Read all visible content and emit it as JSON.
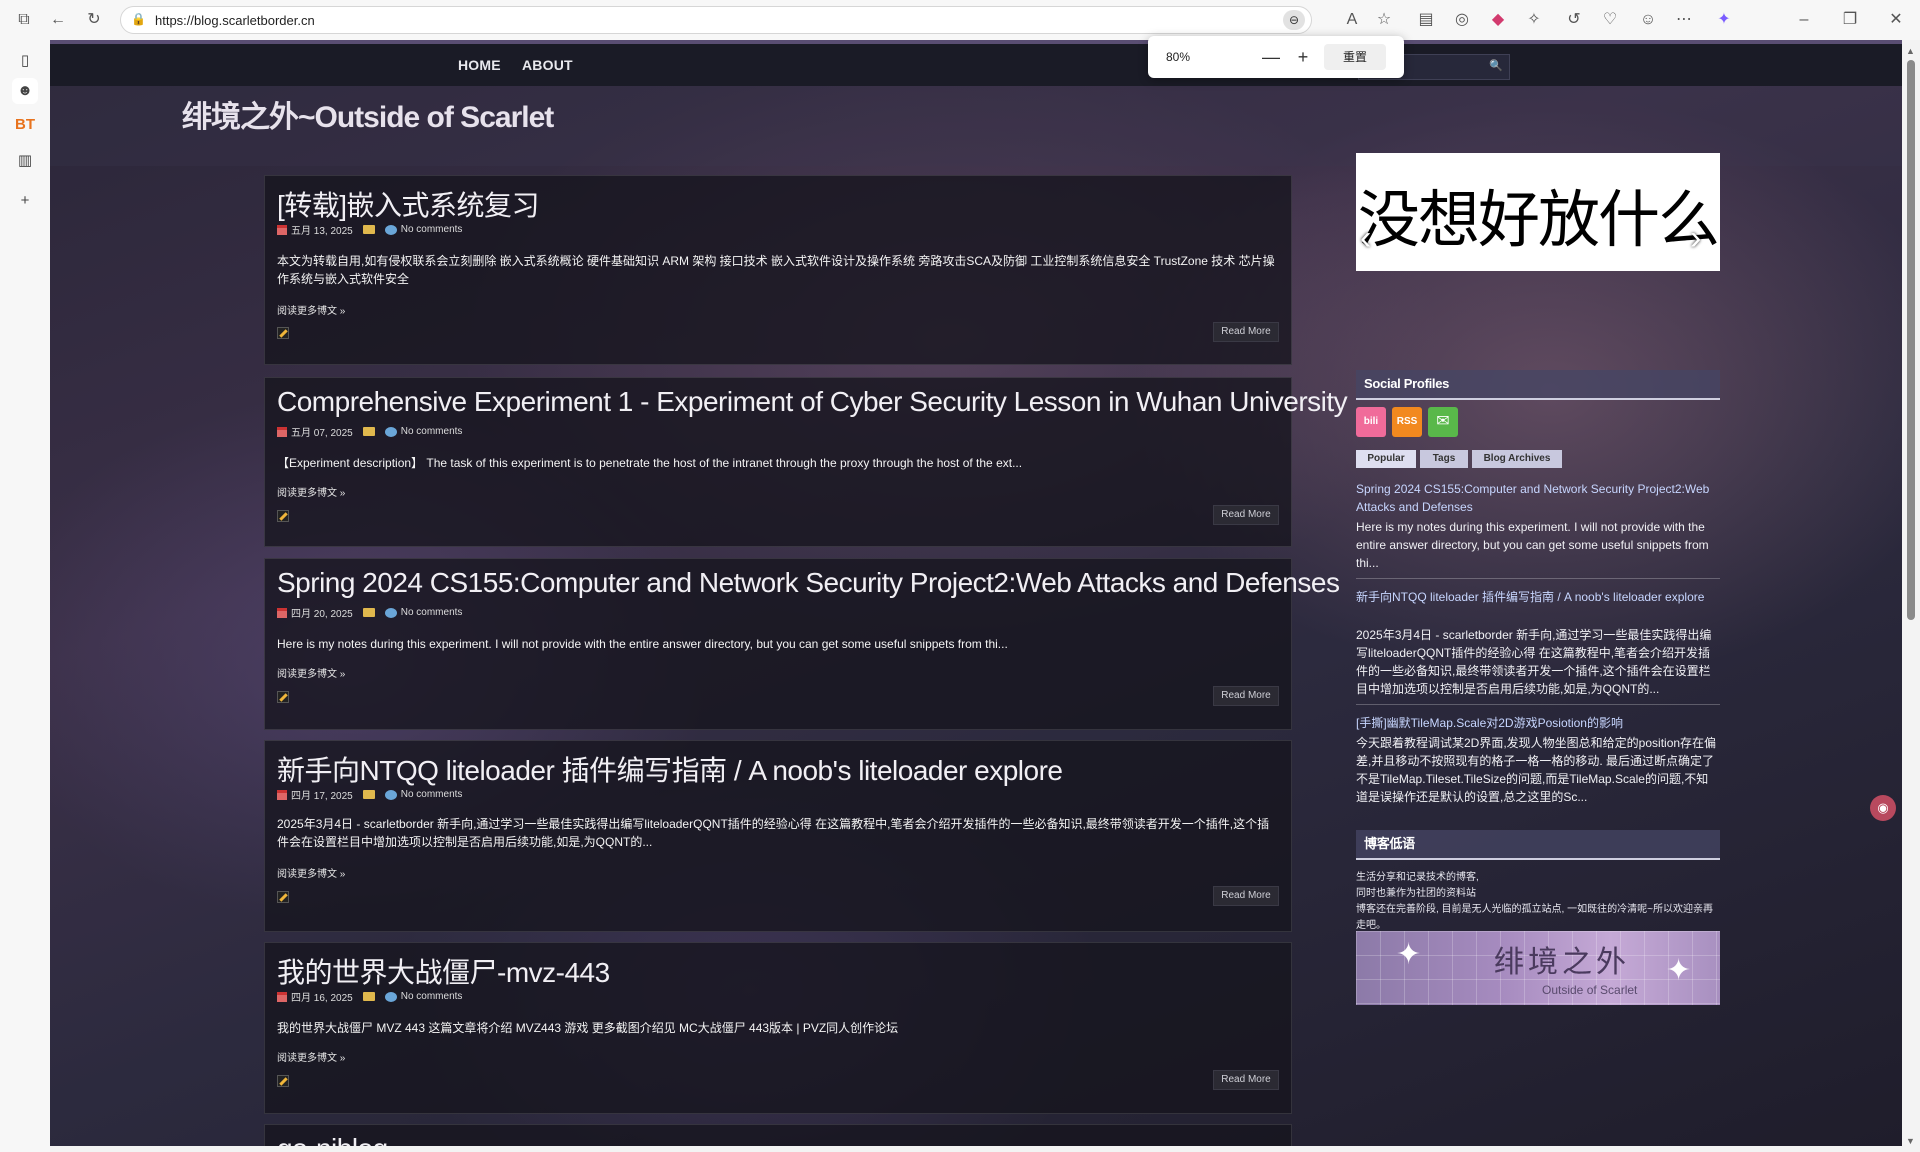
{
  "browser": {
    "url": "https://blog.scarletborder.cn",
    "zoom": {
      "level": "80%",
      "reset_label": "重置",
      "minus": "—",
      "plus": "+"
    }
  },
  "nav": {
    "home": "HOME",
    "about": "ABOUT"
  },
  "site_title": "绯境之外~Outside of Scarlet",
  "posts": [
    {
      "title": "[转载]嵌入式系统复习",
      "date": "五月 13, 2025",
      "comments": "No comments",
      "excerpt": "本文为转载自用,如有侵权联系会立刻删除 嵌入式系统概论 硬件基础知识 ARM 架构 接口技术 嵌入式软件设计及操作系统 旁路攻击SCA及防御 工业控制系统信息安全 TrustZone 技术 芯片操作系统与嵌入式软件安全",
      "more": "阅读更多博文 »",
      "read_more": "Read More"
    },
    {
      "title": "Comprehensive Experiment 1 - Experiment of Cyber Security Lesson in Wuhan University",
      "date": "五月 07, 2025",
      "comments": "No comments",
      "excerpt": "【Experiment description】 The task of this experiment is to penetrate the host of the intranet through the proxy through the host of the ext...",
      "more": "阅读更多博文 »",
      "read_more": "Read More"
    },
    {
      "title": "Spring 2024 CS155:Computer and Network Security Project2:Web Attacks and Defenses",
      "date": "四月 20, 2025",
      "comments": "No comments",
      "excerpt": "Here is my notes during this experiment. I will not provide with the entire answer directory, but you can get some useful snippets from thi...",
      "more": "阅读更多博文 »",
      "read_more": "Read More"
    },
    {
      "title": "新手向NTQQ liteloader 插件编写指南 / A noob's liteloader explore",
      "date": "四月 17, 2025",
      "comments": "No comments",
      "excerpt": "2025年3月4日 - scarletborder 新手向,通过学习一些最佳实践得出编写liteloaderQQNT插件的经验心得 在这篇教程中,笔者会介绍开发插件的一些必备知识,最终带领读者开发一个插件,这个插件会在设置栏目中增加选项以控制是否启用后续功能,如是,为QQNT的...",
      "more": "阅读更多博文 »",
      "read_more": "Read More"
    },
    {
      "title": "我的世界大战僵尸-mvz-443",
      "date": "四月 16, 2025",
      "comments": "No comments",
      "excerpt": "我的世界大战僵尸 MVZ 443 这篇文章将介绍 MVZ443 游戏 更多截图介绍见 MC大战僵尸 443版本 | PVZ同人创作论坛",
      "more": "阅读更多博文 »",
      "read_more": "Read More"
    },
    {
      "title": "go-niblog"
    }
  ],
  "sidebar": {
    "banner_text": "没想好放什么",
    "social_title": "Social Profiles",
    "social": [
      "bilibili",
      "rss",
      "mail"
    ],
    "social_labels": {
      "bilibili": "bili",
      "rss": "RSS",
      "mail": "✉"
    },
    "tabs": [
      "Popular",
      "Tags",
      "Blog Archives"
    ],
    "popular": [
      {
        "title": "Spring 2024 CS155:Computer and Network Security Project2:Web Attacks and Defenses",
        "text": "Here is my notes during this experiment. I will not provide with the entire answer directory, but you can get some useful snippets from thi..."
      },
      {
        "title": "新手向NTQQ liteloader 插件编写指南 / A noob's liteloader explore",
        "text": "2025年3月4日 - scarletborder 新手向,通过学习一些最佳实践得出编写liteloaderQQNT插件的经验心得 在这篇教程中,笔者会介绍开发插件的一些必备知识,最终带领读者开发一个插件,这个插件会在设置栏目中增加选项以控制是否启用后续功能,如是,为QQNT的..."
      },
      {
        "title": "[手撕]幽默TileMap.Scale对2D游戏Posiotion的影响",
        "text": "今天跟着教程调试某2D界面,发现人物坐图总和给定的position存在偏差,并且移动不按照现有的格子一格一格的移动. 最后通过断点确定了不是TileMap.Tileset.TileSize的问题,而是TileMap.Scale的问题,不知道是误操作还是默认的设置,总之这里的Sc..."
      }
    ],
    "about_title": "博客低语",
    "about_text": "生活分享和记录技术的博客,\n同时也兼作为社团的资料站\n博客还在完善阶段, 目前是无人光临的孤立站点, 一如既往的冷清呢~所以欢迎亲再走吧。",
    "about_img_big": "绯境之外",
    "about_img_small": "Outside of Scarlet"
  },
  "colors": {
    "nav_bg": "#1a1b26",
    "link": "#c7d6ff",
    "accent": "#5a4e73"
  }
}
